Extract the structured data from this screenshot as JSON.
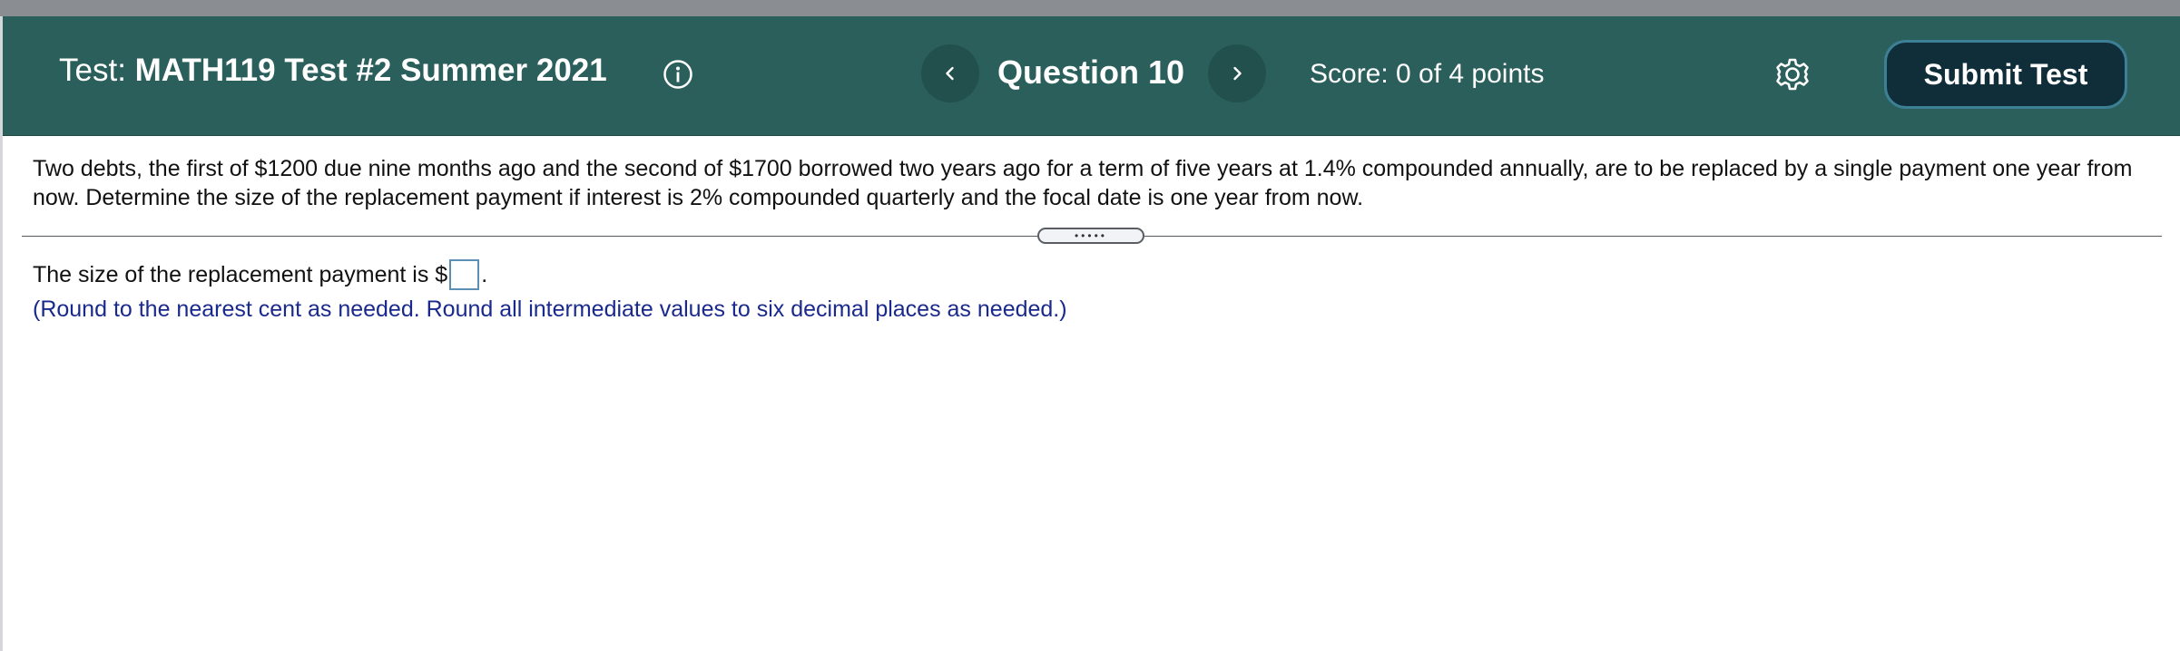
{
  "header": {
    "test_prefix": "Test:",
    "test_name": "MATH119 Test #2 Summer 2021",
    "question_label": "Question 10",
    "score": "Score: 0 of 4 points",
    "submit_label": "Submit Test",
    "icons": {
      "info": "info-icon",
      "prev": "chevron-left-icon",
      "next": "chevron-right-icon",
      "settings": "gear-icon"
    },
    "colors": {
      "background": "#2b5f5c",
      "submit_background": "#0f2e3a",
      "submit_border": "#3d7f95"
    }
  },
  "question": {
    "text": "Two debts, the first of $1200 due nine months ago and the second of $1700 borrowed two years ago for a term of five years at 1.4% compounded annually, are to be replaced by a single payment one year from now. Determine the size of the replacement payment if interest is 2% compounded quarterly and the focal date is one year from now.",
    "divider_handle": "•••••"
  },
  "answer": {
    "prompt": "The size of the replacement payment is $",
    "value": "",
    "suffix": ".",
    "instructions": "(Round to the nearest cent as needed. Round all intermediate values to six decimal places as needed.)",
    "instructions_color": "#1a2a8c"
  }
}
